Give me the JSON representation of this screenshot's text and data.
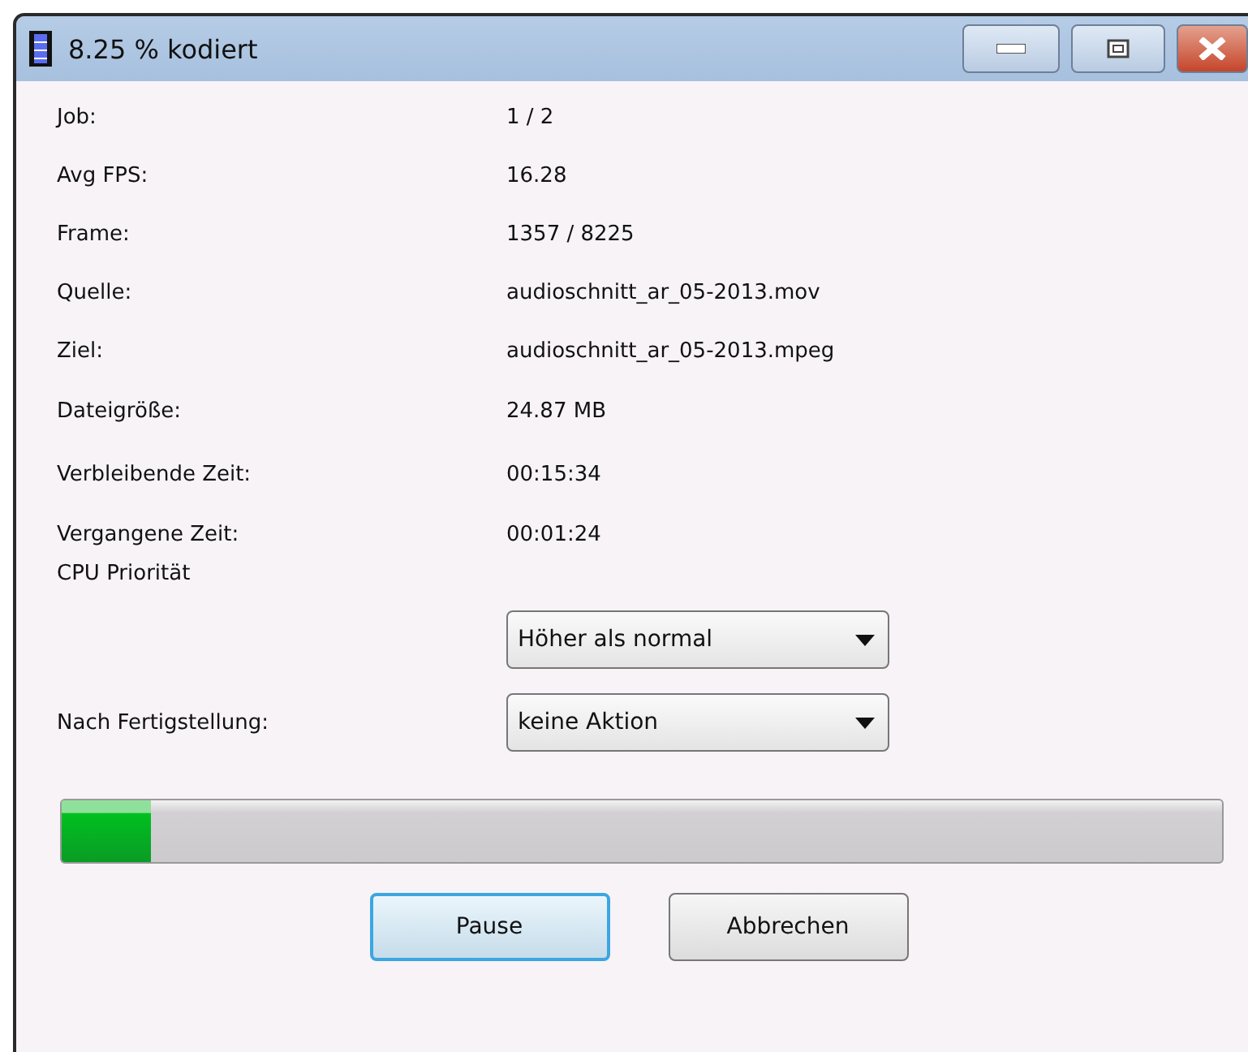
{
  "window": {
    "title": "8.25 % kodiert"
  },
  "info_rows": [
    {
      "label": "Job:",
      "value": "1 / 2"
    },
    {
      "label": "Avg FPS:",
      "value": "16.28"
    },
    {
      "label": "Frame:",
      "value": "1357 / 8225"
    },
    {
      "label": "Quelle:",
      "value": "audioschnitt_ar_05-2013.mov"
    },
    {
      "label": "Ziel:",
      "value": "audioschnitt_ar_05-2013.mpeg"
    },
    {
      "label": "Dateigröße:",
      "value": "24.87 MB"
    },
    {
      "label": "Verbleibende Zeit:",
      "value": "00:15:34"
    },
    {
      "label": "Vergangene Zeit:",
      "value": "00:01:24"
    }
  ],
  "cpu_priority": {
    "label": "CPU Priorität",
    "value": "Höher als normal"
  },
  "after_completion": {
    "label": "Nach Fertigstellung:",
    "value": "keine Aktion"
  },
  "progress": {
    "level": 0.077
  },
  "buttons": [
    {
      "label": "Pause",
      "selected": true
    },
    {
      "label": "Abbrechen",
      "selected": false
    }
  ]
}
